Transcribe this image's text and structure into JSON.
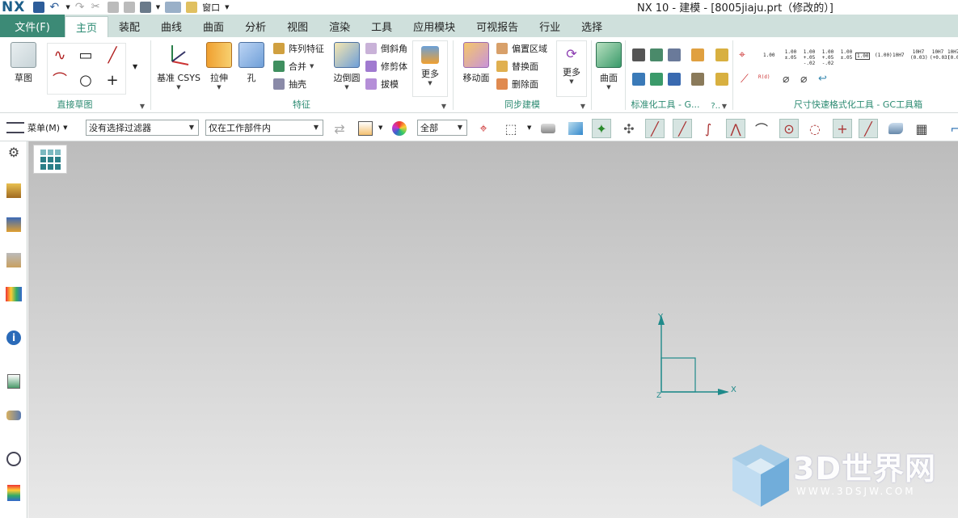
{
  "titlebar": {
    "logo": "NX",
    "window_menu": "窗口",
    "title": "NX 10 - 建模 - [8005jiaju.prt（修改的）]"
  },
  "tabs": {
    "file": "文件(F)",
    "items": [
      "主页",
      "装配",
      "曲线",
      "曲面",
      "分析",
      "视图",
      "渲染",
      "工具",
      "应用模块",
      "可视报告",
      "行业",
      "选择"
    ],
    "active_index": 0
  },
  "ribbon": {
    "direct_sketch": {
      "label": "直接草图",
      "sketch_btn": "草图"
    },
    "feature": {
      "label": "特征",
      "datum_csys": "基准 CSYS",
      "extrude": "拉伸",
      "hole": "孔",
      "pattern_feature": "阵列特征",
      "unite": "合并",
      "shell": "抽壳",
      "edge_blend": "边倒圆",
      "chamfer": "倒斜角",
      "trim_body": "修剪体",
      "draft": "拔模",
      "more": "更多"
    },
    "sync_modeling": {
      "label": "同步建模",
      "move_face": "移动面",
      "offset_region": "偏置区域",
      "replace_face": "替换面",
      "delete_face": "删除面",
      "more": "更多"
    },
    "surface": {
      "surface_btn": "曲面"
    },
    "std_tools": {
      "label": "标准化工具 - G...",
      "collapsed_label": "?.."
    },
    "dim_tools": {
      "label": "尺寸快速格式化工具 - GC工具箱",
      "row1": [
        "1.00",
        "1.00 ±.05",
        "1.00 +.05 -.02",
        "1.00 +.05 -.02",
        "1.00 ±.05",
        "1.00",
        "(1.00)",
        "10H7",
        "10H7 (0.03)",
        "10H7 (+0.03)",
        "10H7 (0.03)"
      ],
      "row2_dia_label": "R(d)"
    }
  },
  "toolbar": {
    "menu": "菜单(M)",
    "filter": "没有选择过滤器",
    "scope": "仅在工作部件内",
    "range": "全部"
  },
  "viewport": {
    "axis_x": "X",
    "axis_y": "Y",
    "axis_z": "Z"
  },
  "watermark": {
    "brand": "3D世界网",
    "url": "WWW.3DSJW.COM"
  },
  "colors": {
    "accent": "#2b8a71",
    "file_tab": "#3c8a76",
    "tab_bar": "#cfe0dc",
    "axis": "#1f8a8a"
  }
}
